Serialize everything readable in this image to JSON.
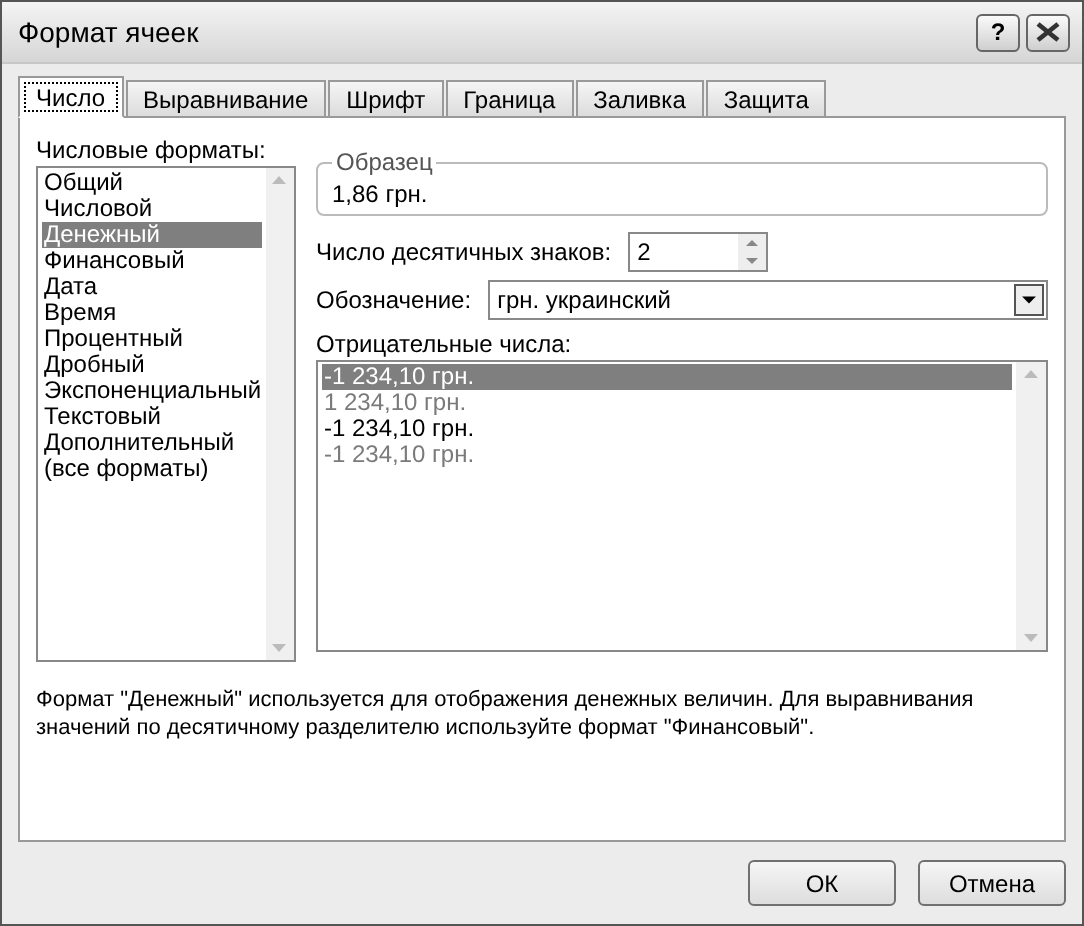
{
  "window": {
    "title": "Формат ячеек",
    "help_button": "?"
  },
  "tabs": [
    {
      "label": "Число",
      "selected": true
    },
    {
      "label": "Выравнивание",
      "selected": false
    },
    {
      "label": "Шрифт",
      "selected": false
    },
    {
      "label": "Граница",
      "selected": false
    },
    {
      "label": "Заливка",
      "selected": false
    },
    {
      "label": "Защита",
      "selected": false
    }
  ],
  "formats": {
    "label": "Числовые форматы:",
    "items": [
      {
        "label": "Общий",
        "selected": false
      },
      {
        "label": "Числовой",
        "selected": false
      },
      {
        "label": "Денежный",
        "selected": true
      },
      {
        "label": "Финансовый",
        "selected": false
      },
      {
        "label": "Дата",
        "selected": false
      },
      {
        "label": "Время",
        "selected": false
      },
      {
        "label": "Процентный",
        "selected": false
      },
      {
        "label": "Дробный",
        "selected": false
      },
      {
        "label": "Экспоненциальный",
        "selected": false
      },
      {
        "label": "Текстовый",
        "selected": false
      },
      {
        "label": "Дополнительный",
        "selected": false
      },
      {
        "label": "(все форматы)",
        "selected": false
      }
    ]
  },
  "sample": {
    "label": "Образец",
    "value": "1,86 грн."
  },
  "decimals": {
    "label": "Число десятичных знаков:",
    "value": "2"
  },
  "symbol": {
    "label": "Обозначение:",
    "value": "грн. украинский"
  },
  "negative": {
    "label": "Отрицательные числа:",
    "items": [
      {
        "label": "-1 234,10 грн.",
        "selected": true
      },
      {
        "label": "1 234,10 грн.",
        "selected": false,
        "color": "#7a7a7a"
      },
      {
        "label": "-1 234,10 грн.",
        "selected": false,
        "color": "#000000"
      },
      {
        "label": "-1 234,10 грн.",
        "selected": false,
        "color": "#7a7a7a"
      }
    ]
  },
  "description": "Формат \"Денежный\" используется для отображения денежных величин. Для выравнивания значений по десятичному разделителю используйте формат \"Финансовый\".",
  "buttons": [
    "ОК",
    "Отмена"
  ]
}
